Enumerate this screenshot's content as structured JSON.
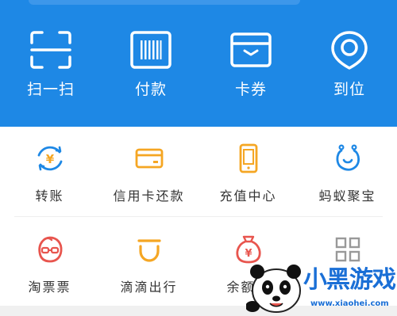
{
  "quick_actions": [
    {
      "label": "扫一扫",
      "icon": "scan-icon"
    },
    {
      "label": "付款",
      "icon": "barcode-icon"
    },
    {
      "label": "卡券",
      "icon": "card-wallet-icon"
    },
    {
      "label": "到位",
      "icon": "location-pin-icon"
    }
  ],
  "services_row1": [
    {
      "label": "转账",
      "icon": "transfer-icon",
      "color": "#1e88e5"
    },
    {
      "label": "信用卡还款",
      "icon": "credit-card-icon",
      "color": "#f5a623"
    },
    {
      "label": "充值中心",
      "icon": "phone-recharge-icon",
      "color": "#f5a623"
    },
    {
      "label": "蚂蚁聚宝",
      "icon": "ant-fortune-icon",
      "color": "#1e88e5"
    }
  ],
  "services_row2": [
    {
      "label": "淘票票",
      "icon": "taopiaopiao-icon",
      "color": "#e8554e"
    },
    {
      "label": "滴滴出行",
      "icon": "didi-icon",
      "color": "#f5a623"
    },
    {
      "label": "余额宝",
      "icon": "money-bag-icon",
      "color": "#e8554e"
    },
    {
      "label": "",
      "icon": "more-grid-icon",
      "color": "#999999"
    }
  ],
  "watermark": {
    "text": "小黑游戏",
    "url": "www.xiaohei.com"
  },
  "colors": {
    "header_blue": "#1e88e5",
    "label_text": "#333333"
  }
}
